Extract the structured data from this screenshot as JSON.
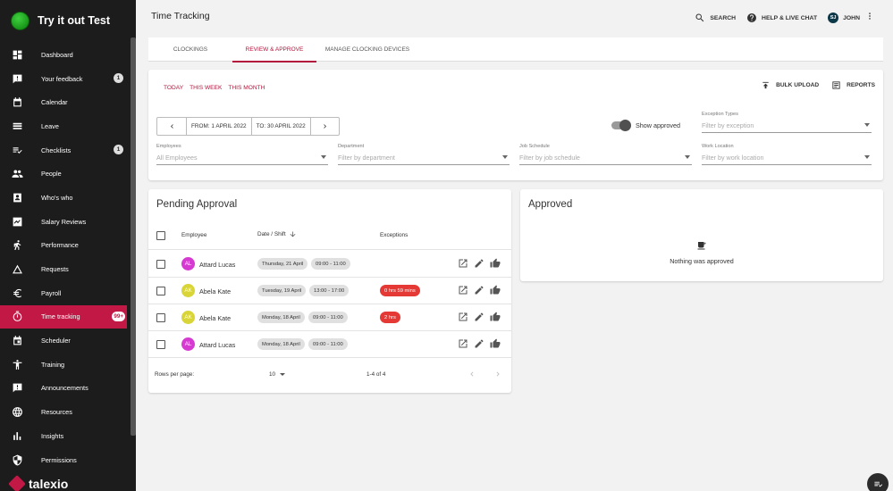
{
  "brand": {
    "name": "Try it out Test"
  },
  "sidebar": {
    "items": [
      {
        "label": "Dashboard",
        "icon": "dashboard-icon"
      },
      {
        "label": "Your feedback",
        "icon": "feedback-icon",
        "badge": "1"
      },
      {
        "label": "Calendar",
        "icon": "calendar-icon"
      },
      {
        "label": "Leave",
        "icon": "leave-icon"
      },
      {
        "label": "Checklists",
        "icon": "checklist-icon",
        "badge": "1"
      },
      {
        "label": "People",
        "icon": "people-icon"
      },
      {
        "label": "Who's who",
        "icon": "contact-card-icon"
      },
      {
        "label": "Salary Reviews",
        "icon": "trend-chart-icon"
      },
      {
        "label": "Performance",
        "icon": "running-person-icon"
      },
      {
        "label": "Requests",
        "icon": "triangle-icon"
      },
      {
        "label": "Payroll",
        "icon": "euro-icon"
      },
      {
        "label": "Time tracking",
        "icon": "timer-icon",
        "badge": "99+",
        "active": true
      },
      {
        "label": "Scheduler",
        "icon": "scheduler-icon"
      },
      {
        "label": "Training",
        "icon": "person-arms-icon"
      },
      {
        "label": "Announcements",
        "icon": "announcement-icon"
      },
      {
        "label": "Resources",
        "icon": "globe-icon"
      },
      {
        "label": "Insights",
        "icon": "bar-chart-icon"
      },
      {
        "label": "Permissions",
        "icon": "shield-icon"
      }
    ],
    "footer_brand": "talexio"
  },
  "header": {
    "title": "Time Tracking",
    "search_label": "SEARCH",
    "help_label": "HELP & LIVE CHAT",
    "user_initials": "SJ",
    "user_name": "JOHN"
  },
  "tabs": [
    {
      "label": "CLOCKINGS"
    },
    {
      "label": "REVIEW & APPROVE",
      "active": true
    },
    {
      "label": "MANAGE CLOCKING DEVICES"
    }
  ],
  "filters": {
    "range_links": [
      "TODAY",
      "THIS WEEK",
      "THIS MONTH"
    ],
    "bulk_upload_label": "BULK UPLOAD",
    "reports_label": "REPORTS",
    "from_label": "FROM: 1 APRIL 2022",
    "to_label": "TO: 30 APRIL 2022",
    "show_approved_label": "Show approved",
    "show_approved": true,
    "exception_types": {
      "label": "Exception Types",
      "placeholder": "Filter by exception"
    },
    "employees": {
      "label": "Employees",
      "value": "All Employees"
    },
    "department": {
      "label": "Department",
      "placeholder": "Filter by department"
    },
    "job_schedule": {
      "label": "Job Schedule",
      "placeholder": "Filter by job schedule"
    },
    "work_location": {
      "label": "Work Location",
      "placeholder": "Filter by work location"
    }
  },
  "pending": {
    "title": "Pending Approval",
    "columns": {
      "employee": "Employee",
      "date_shift": "Date / Shift",
      "exceptions": "Exceptions"
    },
    "rows": [
      {
        "initials": "AL",
        "name": "Attard Lucas",
        "avatar_color": "#d63bd1",
        "date": "Thursday, 21 April",
        "shift": "09:00 - 11:00",
        "exception": ""
      },
      {
        "initials": "AK",
        "name": "Abela Kate",
        "avatar_color": "#d9d437",
        "date": "Tuesday, 19 April",
        "shift": "13:00 - 17:00",
        "exception": "0 hrs 59 mins"
      },
      {
        "initials": "AK",
        "name": "Abela Kate",
        "avatar_color": "#d9d437",
        "date": "Monday, 18 April",
        "shift": "09:00 - 11:00",
        "exception": "2 hrs"
      },
      {
        "initials": "AL",
        "name": "Attard Lucas",
        "avatar_color": "#d63bd1",
        "date": "Monday, 18 April",
        "shift": "09:00 - 11:00",
        "exception": ""
      }
    ],
    "rows_per_page_label": "Rows per page:",
    "rows_per_page": "10",
    "range_text": "1-4 of 4"
  },
  "approved": {
    "title": "Approved",
    "empty_text": "Nothing was approved"
  }
}
